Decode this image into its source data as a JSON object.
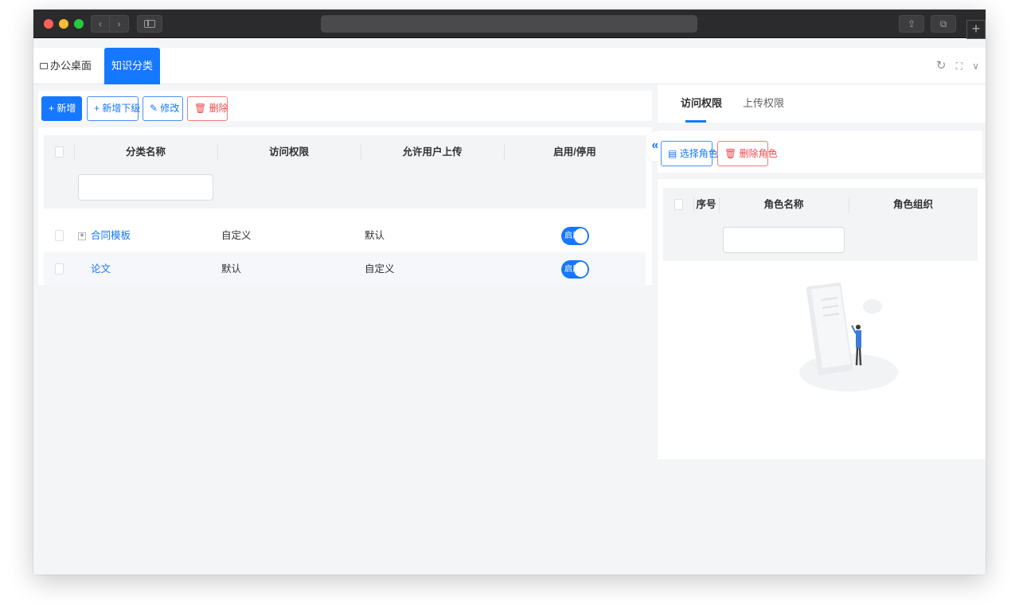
{
  "browser": {
    "nav_back": "‹",
    "nav_forward": "›",
    "share": "⇪",
    "tabs": "⧉",
    "new_tab": "+"
  },
  "app_tabs": {
    "home": {
      "label": "办公桌面",
      "chevron": "∨"
    },
    "active": {
      "label": "知识分类",
      "close": "x"
    },
    "tools": {
      "refresh": "↻",
      "fullscreen": "⛶",
      "more": "∨"
    }
  },
  "toolbar": {
    "add": "+ 新增",
    "add_child": "+ 新增下级",
    "edit": "修改",
    "delete": "删除"
  },
  "table": {
    "columns": [
      "分类名称",
      "访问权限",
      "允许用户上传",
      "启用/停用"
    ],
    "rows": [
      {
        "name": "合同模板",
        "expandable": true,
        "expand_glyph": "+",
        "access": "自定义",
        "upload": "默认",
        "status": "启用",
        "enabled": true
      },
      {
        "name": "论文",
        "expandable": false,
        "expand_glyph": "",
        "access": "默认",
        "upload": "自定义",
        "status": "启用",
        "enabled": true
      }
    ]
  },
  "collapse_handle": "«",
  "right_panel": {
    "tabs": [
      {
        "label": "访问权限",
        "active": true
      },
      {
        "label": "上传权限",
        "active": false
      }
    ],
    "buttons": {
      "select_role": "选择角色",
      "delete_role": "删除角色"
    },
    "columns": [
      "序号",
      "角色名称",
      "角色组织"
    ]
  },
  "colors": {
    "primary": "#1677ff",
    "danger": "#f0484b",
    "header_bg": "#f3f4f6",
    "page_bg": "#f4f5f7",
    "titlebar": "#2b2b2d"
  }
}
